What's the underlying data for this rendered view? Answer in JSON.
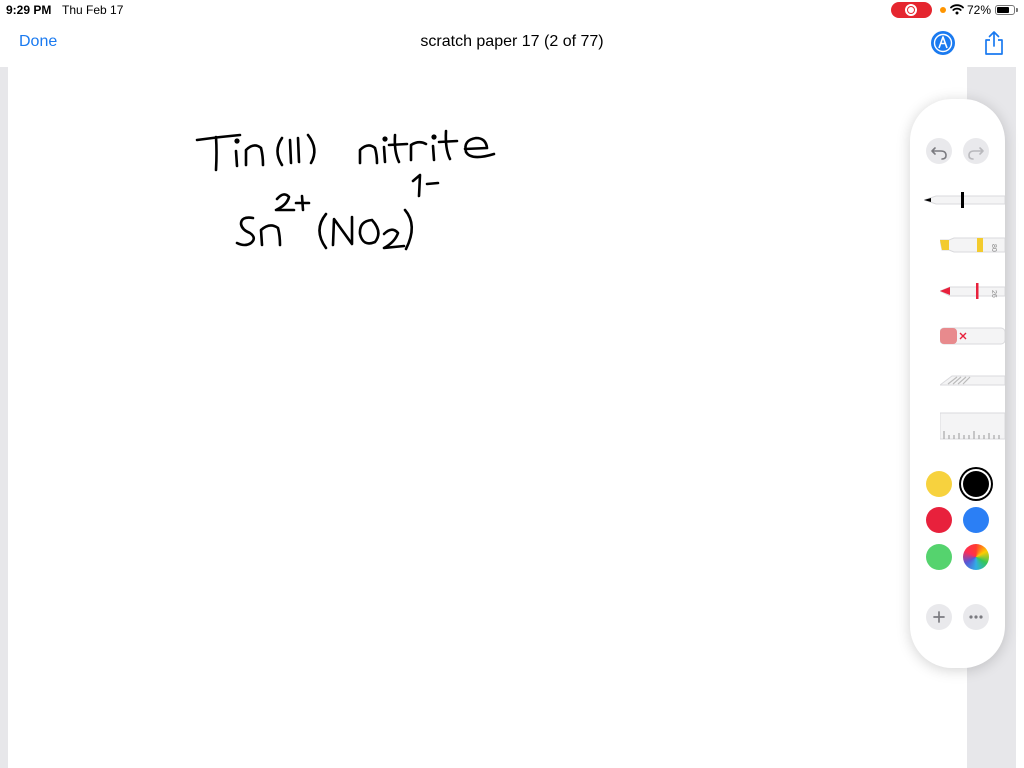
{
  "status_bar": {
    "time": "9:29 PM",
    "date": "Thu Feb 17",
    "battery_percent": "72%",
    "battery_level": 0.72,
    "recording": true
  },
  "nav": {
    "done_label": "Done",
    "title": "scratch paper 17 (2 of 77)"
  },
  "tool_palette": {
    "tools": [
      {
        "name": "pen",
        "selected": true
      },
      {
        "name": "highlighter",
        "opacity_label": "80"
      },
      {
        "name": "marker",
        "opacity_label": "26"
      },
      {
        "name": "eraser"
      },
      {
        "name": "lasso"
      },
      {
        "name": "ruler"
      }
    ],
    "colors": [
      "#f7d23e",
      "#000000",
      "#e8213c",
      "#2b7ff5",
      "#55d36e",
      "color-wheel"
    ],
    "selected_color": "#000000"
  },
  "colors": {
    "accent": "#1a7af0",
    "recording": "#e5262f"
  }
}
